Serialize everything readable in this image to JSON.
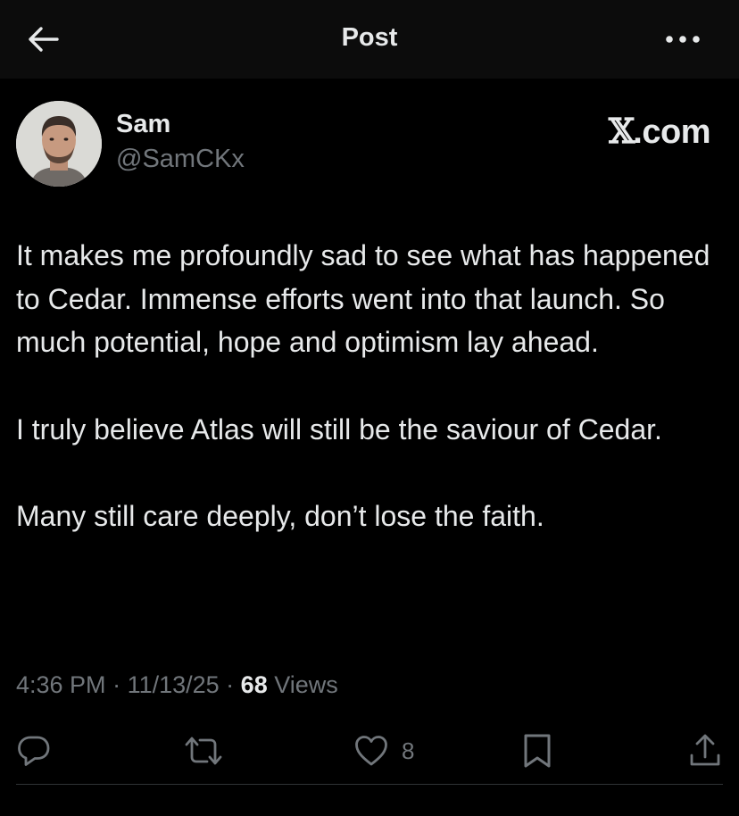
{
  "header": {
    "title": "Post",
    "back_icon": "arrow-left-icon",
    "more_icon": "more-dots-icon"
  },
  "author": {
    "name": "Sam",
    "handle": "@SamCKx"
  },
  "watermark": {
    "x_mark": "𝕏",
    "domain": ".com"
  },
  "post": {
    "paragraphs": [
      "It makes me profoundly sad to see what has happened to Cedar. Immense efforts went into that launch. So much potential, hope and optimism lay ahead.",
      "I truly believe Atlas will still be the saviour of Cedar.",
      "Many still care deeply, don’t lose the faith."
    ],
    "time": "4:36 PM",
    "date": "11/13/25",
    "views_count": "68",
    "views_label": "Views"
  },
  "actions": {
    "reply_icon": "reply-icon",
    "repost_icon": "repost-icon",
    "like_icon": "heart-icon",
    "like_count": "8",
    "bookmark_icon": "bookmark-icon",
    "share_icon": "share-icon"
  },
  "colors": {
    "background": "#000000",
    "header_background": "#0c0c0c",
    "text_primary": "#e7e9ea",
    "text_secondary": "#71767b",
    "divider": "#2f3336"
  }
}
